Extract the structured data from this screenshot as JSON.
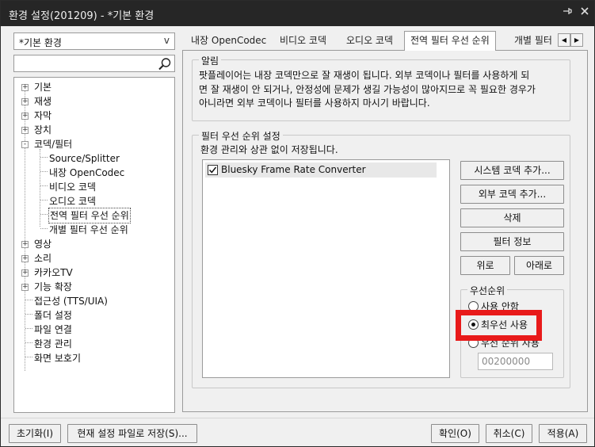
{
  "window": {
    "title": "환경 설정(201209) - *기본 환경",
    "pin_icon": "pin-icon",
    "close_icon": "close-icon"
  },
  "preset": {
    "value": "*기본 환경",
    "arrow": "v"
  },
  "search": {
    "placeholder": "",
    "icon": "search-icon"
  },
  "tree": {
    "items": [
      {
        "label": "기본",
        "expander": "+"
      },
      {
        "label": "재생",
        "expander": "+"
      },
      {
        "label": "자막",
        "expander": "+"
      },
      {
        "label": "장치",
        "expander": "+"
      },
      {
        "label": "코덱/필터",
        "expander": "-"
      },
      {
        "label": "Source/Splitter"
      },
      {
        "label": "내장 OpenCodec"
      },
      {
        "label": "비디오 코덱"
      },
      {
        "label": "오디오 코덱"
      },
      {
        "label": "전역 필터 우선 순위",
        "selected": true
      },
      {
        "label": "개별 필터 우선 순위"
      },
      {
        "label": "영상",
        "expander": "+"
      },
      {
        "label": "소리",
        "expander": "+"
      },
      {
        "label": "카카오TV",
        "expander": "+"
      },
      {
        "label": "기능 확장",
        "expander": "+"
      },
      {
        "label": "접근성 (TTS/UIA)"
      },
      {
        "label": "폴더 설정"
      },
      {
        "label": "파일 연결"
      },
      {
        "label": "환경 관리"
      },
      {
        "label": "화면 보호기"
      }
    ]
  },
  "tabs": [
    {
      "label": "내장 OpenCodec"
    },
    {
      "label": "비디오 코덱"
    },
    {
      "label": "오디오 코덱"
    },
    {
      "label": "전역 필터 우선 순위",
      "active": true
    },
    {
      "label": "개별 필터"
    }
  ],
  "tab_scroll": {
    "left": "◀",
    "right": "▶"
  },
  "notice": {
    "legend": "알림",
    "lines": [
      "팟플레이어는 내장 코덱만으로 잘 재생이 됩니다. 외부 코덱이나 필터를 사용하게 되",
      "면 잘 재생이 안 되거나, 안정성에 문제가 생길 가능성이 많아지므로 꼭 필요한 경우가",
      "아니라면 외부 코덱이나 필터를 사용하지 마시기 바랍니다."
    ]
  },
  "filter_priority": {
    "legend": "필터 우선 순위 설정",
    "description": "환경 관리와 상관 없이 저장됩니다.",
    "filters": [
      {
        "name": "Bluesky Frame Rate Converter",
        "checked": true
      }
    ],
    "buttons": {
      "add_system": "시스템 코덱 추가...",
      "add_external": "외부 코덱 추가...",
      "delete": "삭제",
      "filter_info": "필터 정보",
      "up": "위로",
      "down": "아래로"
    },
    "priority": {
      "legend": "우선순위",
      "options": [
        {
          "label": "사용 안함",
          "selected": false
        },
        {
          "label": "최우선 사용",
          "selected": true
        },
        {
          "label": "우선 순위 사용",
          "selected": false
        }
      ],
      "order_value": "00200000"
    },
    "highlight_color": "#e81a1a"
  },
  "footer": {
    "reset": "초기화(I)",
    "save_current": "현재 설정 파일로 저장(S)...",
    "ok": "확인(O)",
    "cancel": "취소(C)",
    "apply": "적용(A)"
  }
}
